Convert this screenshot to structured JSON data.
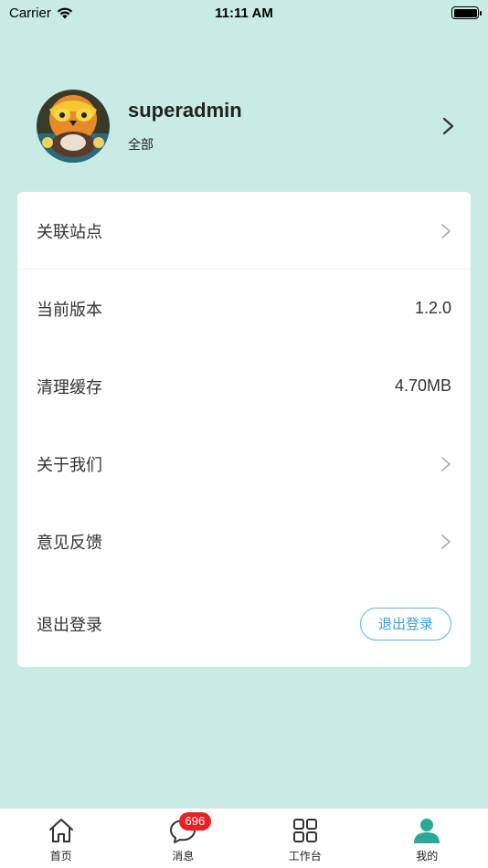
{
  "status_bar": {
    "carrier": "Carrier",
    "time": "11:11 AM"
  },
  "profile": {
    "username": "superadmin",
    "org": "全部"
  },
  "menu": {
    "related_sites": "关联站点",
    "version_label": "当前版本",
    "version_value": "1.2.0",
    "cache_label": "清理缓存",
    "cache_value": "4.70MB",
    "about_label": "关于我们",
    "feedback_label": "意见反馈",
    "logout_label": "退出登录",
    "logout_button": "退出登录"
  },
  "tabbar": {
    "tabs": [
      {
        "label": "首页",
        "icon": "home-icon"
      },
      {
        "label": "消息",
        "icon": "message-icon",
        "badge": "696"
      },
      {
        "label": "工作台",
        "icon": "grid-icon"
      },
      {
        "label": "我的",
        "icon": "person-icon",
        "active": true
      }
    ]
  },
  "colors": {
    "background": "#c8ebe5",
    "accent": "#3aa0dc",
    "active_tab": "#2ba89a",
    "badge": "#e82222"
  }
}
